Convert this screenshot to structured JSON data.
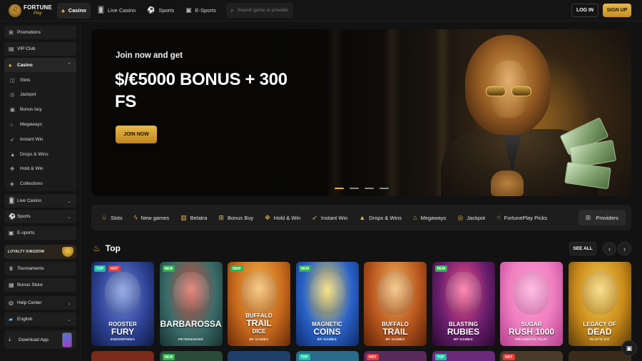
{
  "brand": {
    "name_line1": "FORTUNE",
    "name_line2": "Play"
  },
  "header": {
    "tabs": [
      {
        "label": "Casino",
        "icon": "spade-icon",
        "active": true
      },
      {
        "label": "Live Casino",
        "icon": "cards-icon",
        "active": false
      },
      {
        "label": "Sports",
        "icon": "ball-icon",
        "active": false
      },
      {
        "label": "E-Sports",
        "icon": "gamepad-icon",
        "active": false
      }
    ],
    "search_placeholder": "Search game or provider",
    "login_label": "LOG IN",
    "signup_label": "SIGN UP"
  },
  "sidebar": {
    "promotions": "Promotions",
    "vip": "VIP Club",
    "casino": "Casino",
    "casino_items": [
      "Slots",
      "Jackpot",
      "Bonus buy",
      "Megaways",
      "Instant Win",
      "Drops & Wins",
      "Hold & Win",
      "Collections"
    ],
    "live_casino": "Live Casino",
    "sports": "Sports",
    "esports": "E-sports",
    "loyalty": "LOYALTY KINGDOM",
    "tournaments": "Tournaments",
    "bonus_store": "Bonus Store",
    "help": "Help Center",
    "language": "English",
    "download": "Download App"
  },
  "banner": {
    "kicker": "Join now and get",
    "title": "$/€5000 BONUS + 300 FS",
    "cta": "JOIN NOW",
    "slides": 4,
    "active_slide": 1
  },
  "categories": [
    {
      "label": "Slots",
      "icon": "slots-icon"
    },
    {
      "label": "New games",
      "icon": "lightning-icon"
    },
    {
      "label": "Belatra",
      "icon": "belatra-icon"
    },
    {
      "label": "Bonus Buy",
      "icon": "gift-icon"
    },
    {
      "label": "Hold & Win",
      "icon": "hold-icon"
    },
    {
      "label": "Instant Win",
      "icon": "rocket-icon"
    },
    {
      "label": "Drops & Wins",
      "icon": "drops-icon"
    },
    {
      "label": "Megaways",
      "icon": "megaways-icon"
    },
    {
      "label": "Jackpot",
      "icon": "jackpot-icon"
    },
    {
      "label": "FortunePlay Picks",
      "icon": "thumbs-up-icon"
    }
  ],
  "providers_label": "Providers",
  "top_section": {
    "title": "Top",
    "see_all": "SEE ALL",
    "games": [
      {
        "line1": "ROOSTER",
        "line2": "FURY",
        "provider": "ENDORPHINA",
        "badges": [
          "TOP",
          "HOT"
        ],
        "bg": "#2b3f8f"
      },
      {
        "line1": "",
        "line2": "BARBAROSSA",
        "provider": "PETER&SONS",
        "badges": [
          "NEW"
        ],
        "bg": "#3a6d6a"
      },
      {
        "line1": "BUFFALO",
        "line2": "TRAIL",
        "line3": "DICE",
        "provider": "BF GAMES",
        "badges": [
          "NEW"
        ],
        "bg": "#c86a1e"
      },
      {
        "line1": "MAGNETIC",
        "line2": "COINS",
        "provider": "BF GAMES",
        "badges": [
          "NEW"
        ],
        "bg": "#2a63c9"
      },
      {
        "line1": "BUFFALO",
        "line2": "TRAIL",
        "provider": "BF GAMES",
        "badges": [],
        "bg": "#b8561e"
      },
      {
        "line1": "BLASTING",
        "line2": "RUBIES",
        "provider": "BF GAMES",
        "badges": [
          "NEW"
        ],
        "bg": "#6a1f6e"
      },
      {
        "line1": "SUGAR",
        "line2": "RUSH 1000",
        "provider": "PRAGMATIC PLAY",
        "badges": [],
        "bg": "#f07fc0"
      },
      {
        "line1": "LEGACY OF",
        "line2": "DEAD",
        "provider": "PLAY'N GO",
        "badges": [],
        "bg": "#c98a1a"
      }
    ],
    "row2_badges": [
      [],
      [
        "NEW"
      ],
      [],
      [
        "TOP"
      ],
      [
        "HOT"
      ],
      [
        "TOP"
      ],
      [
        "HOT"
      ],
      []
    ]
  }
}
